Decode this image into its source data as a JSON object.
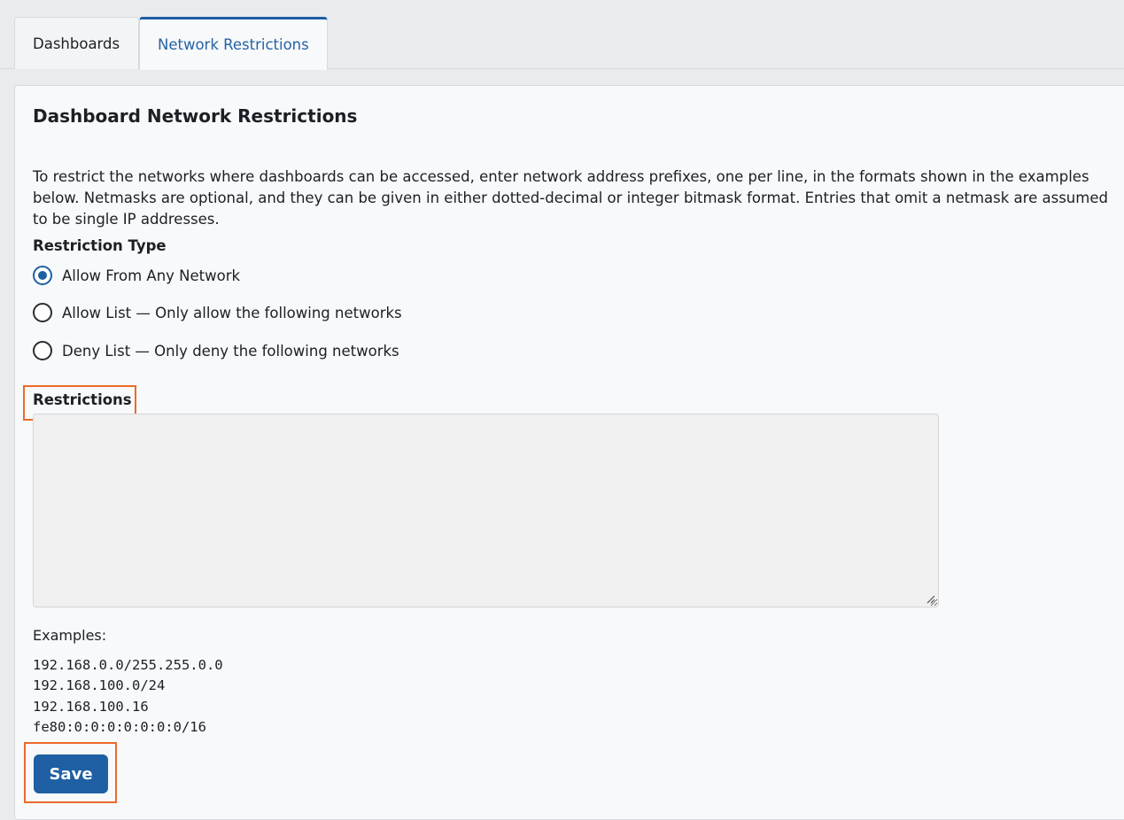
{
  "tabs": {
    "dashboards": "Dashboards",
    "network_restrictions": "Network Restrictions"
  },
  "page": {
    "title": "Dashboard Network Restrictions",
    "description": "To restrict the networks where dashboards can be accessed, enter network address prefixes, one per line, in the formats shown in the examples below. Netmasks are optional, and they can be given in either dotted-decimal or integer bitmask format. Entries that omit a netmask are assumed to be single IP addresses."
  },
  "restriction_type": {
    "label": "Restriction Type",
    "options": [
      {
        "label": "Allow From Any Network",
        "selected": true
      },
      {
        "label": "Allow List — Only allow the following networks",
        "selected": false
      },
      {
        "label": "Deny List — Only deny the following networks",
        "selected": false
      }
    ]
  },
  "restrictions": {
    "label": "Restrictions",
    "value": ""
  },
  "examples": {
    "label": "Examples:",
    "items": [
      "192.168.0.0/255.255.0.0",
      "192.168.100.0/24",
      "192.168.100.16",
      "fe80:0:0:0:0:0:0:0/16"
    ]
  },
  "actions": {
    "save_label": "Save"
  },
  "colors": {
    "accent": "#1f5fa3",
    "highlight": "#ec6a2b",
    "background": "#e9ebee",
    "panel": "#f8f9fa"
  }
}
